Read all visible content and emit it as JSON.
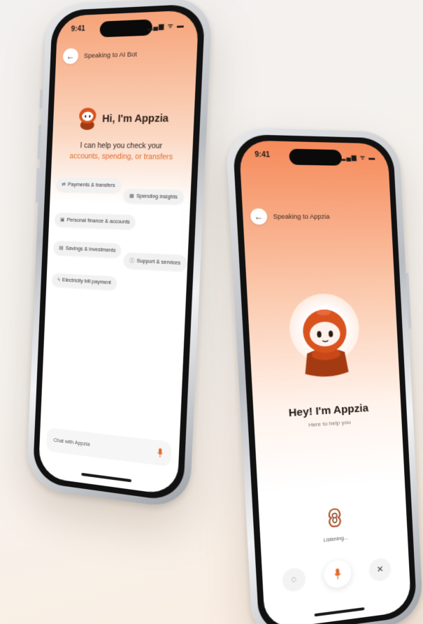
{
  "colors": {
    "accent": "#e06a2c",
    "bot_body": "#d9531f",
    "bot_dark": "#a33a12",
    "background": "#f4f1ee"
  },
  "phone1": {
    "status_time": "9:41",
    "status_icons": "▂▄▆ ᯤ ▬",
    "header": {
      "back_icon": "arrow-left-icon",
      "title": "Speaking to AI Bot"
    },
    "greeting": {
      "title": "Hi, I'm Appzia",
      "line1": "I can help you check your",
      "line2": "accounts, spending, or transfers"
    },
    "chips": [
      {
        "icon": "⇄",
        "label": "Payments & transfers"
      },
      {
        "icon": "▦",
        "label": "Spending insights"
      },
      {
        "icon": "▣",
        "label": "Personal finance & accounts"
      },
      {
        "icon": "▤",
        "label": "Savings & investments"
      },
      {
        "icon": "ⓘ",
        "label": "Support & services"
      },
      {
        "icon": "ϟ",
        "label": "Electricity bill payment"
      }
    ],
    "chat_placeholder": "Chat with Appzia",
    "mic_icon": "microphone-icon"
  },
  "phone2": {
    "status_time": "9:41",
    "status_icons": "▂▄▆ ᯤ ▬",
    "header": {
      "back_icon": "arrow-left-icon",
      "title": "Speaking to Appzia"
    },
    "title": "Hey! I'm Appzia",
    "subtitle": "Here to help you",
    "listening": "Listening...",
    "controls": {
      "left": "◌",
      "right": "✕"
    }
  }
}
